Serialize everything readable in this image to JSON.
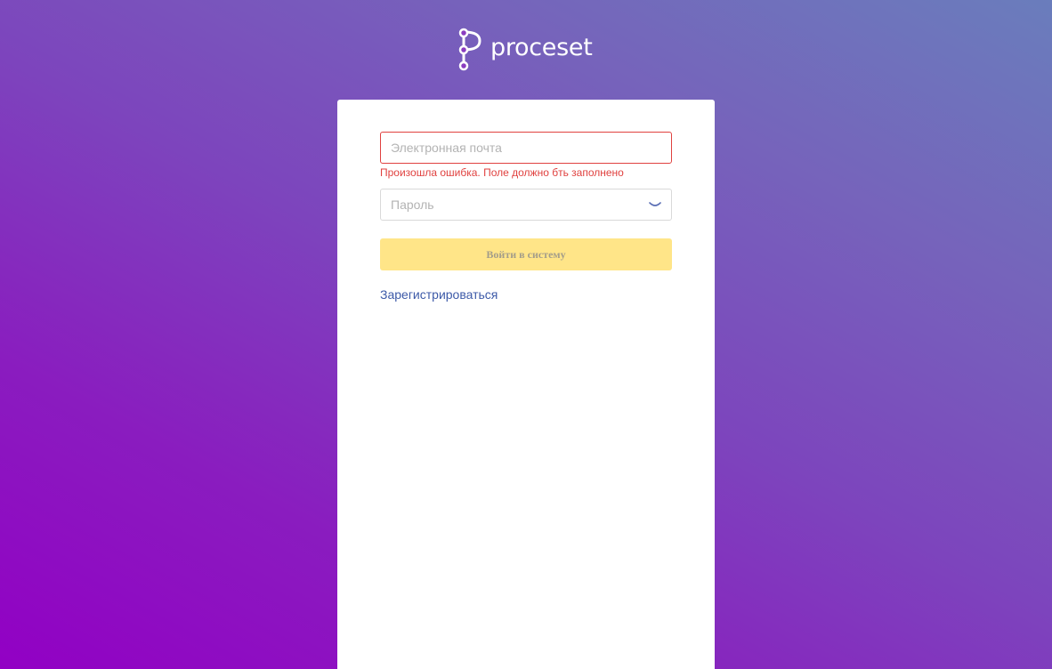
{
  "brand": {
    "logo_icon": "proceset-logo-icon",
    "name": "proceset"
  },
  "login_form": {
    "email": {
      "placeholder": "Электронная почта",
      "value": "",
      "error": "Произошла ошибка. Поле должно бть заполнено"
    },
    "password": {
      "placeholder": "Пароль",
      "value": "",
      "toggle_icon": "eye-closed-icon"
    },
    "submit_label": "Войти в систему",
    "register_label": "Зарегистрироваться"
  },
  "colors": {
    "gradient_start": "#9200c4",
    "gradient_end": "#6a7dbc",
    "error": "#e0413f",
    "button_disabled_bg": "#ffe588",
    "button_disabled_text": "#a39d8a",
    "link": "#3d5aa8"
  }
}
